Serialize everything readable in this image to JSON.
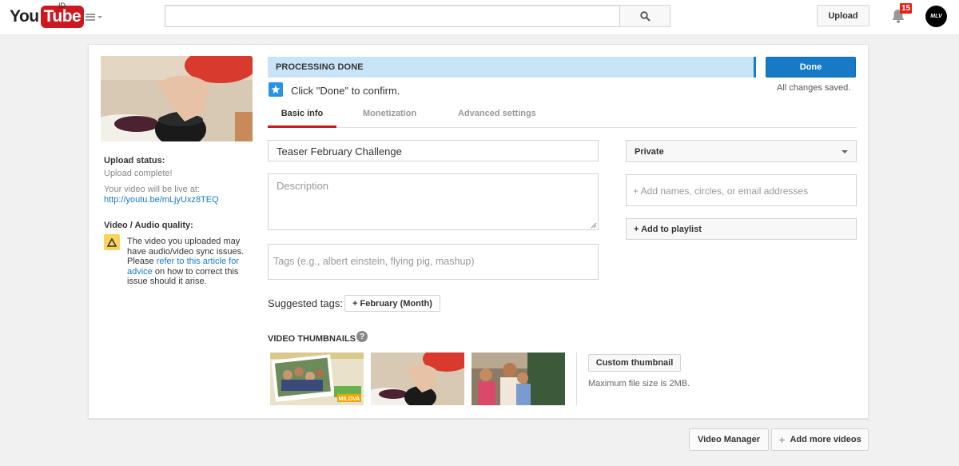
{
  "header": {
    "logo_you": "You",
    "logo_tube": "Tube",
    "country": "ID",
    "search_placeholder": "",
    "upload_label": "Upload",
    "notification_count": "15",
    "avatar_text": "MLV"
  },
  "status": {
    "processing_label": "PROCESSING DONE",
    "done_label": "Done",
    "saved_text": "All changes saved.",
    "confirm_text": "Click \"Done\" to confirm."
  },
  "sidebar": {
    "upload_status_label": "Upload status:",
    "upload_complete": "Upload complete!",
    "live_at": "Your video will be live at:",
    "video_url": "http://youtu.be/mLjyUxz8TEQ",
    "quality_label": "Video / Audio quality:",
    "warning_pre": "The video you uploaded may have audio/video sync issues. Please ",
    "warning_link": "refer to this article for advice",
    "warning_post": " on how to correct this issue should it arise."
  },
  "tabs": [
    {
      "label": "Basic info",
      "active": true
    },
    {
      "label": "Monetization",
      "active": false
    },
    {
      "label": "Advanced settings",
      "active": false
    }
  ],
  "form": {
    "title_value": "Teaser February Challenge",
    "description_placeholder": "Description",
    "tags_placeholder": "Tags (e.g., albert einstein, flying pig, mashup)",
    "privacy_value": "Private",
    "share_placeholder": "+ Add names, circles, or email addresses",
    "playlist_label": "+ Add to playlist",
    "suggested_label": "Suggested tags:",
    "suggested_tag": "+ February (Month)"
  },
  "thumbnails": {
    "section_label": "VIDEO THUMBNAILS",
    "help": "?",
    "thumb1_caption": "MILOVA",
    "custom_label": "Custom thumbnail",
    "max_size": "Maximum file size is 2MB."
  },
  "footer": {
    "video_manager": "Video Manager",
    "add_more_plus": "+",
    "add_more": "Add more videos"
  },
  "colors": {
    "brand_red": "#cc181e",
    "accent_blue": "#167ac6",
    "processing_bg": "#c9e4f7"
  }
}
